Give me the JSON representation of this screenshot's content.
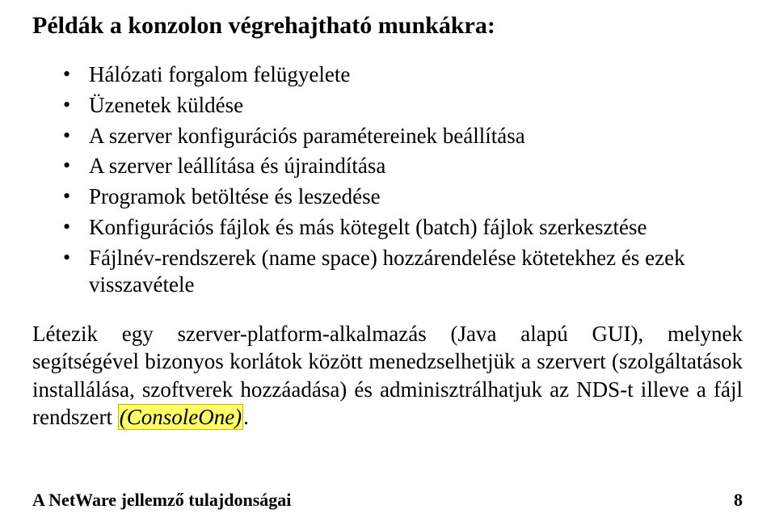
{
  "heading": "Példák a konzolon végrehajtható munkákra:",
  "bullets": [
    "Hálózati forgalom felügyelete",
    "Üzenetek küldése",
    "A szerver konfigurációs paramétereinek beállítása",
    "A szerver leállítása és újraindítása",
    "Programok betöltése és leszedése",
    "Konfigurációs fájlok és más kötegelt (batch) fájlok szerkesztése",
    "Fájlnév-rendszerek (name space) hozzárendelése kötetekhez és ezek visszavétele"
  ],
  "paragraph": {
    "pre": "Létezik egy szerver-platform-alkalmazás (Java alapú GUI), melynek segítségével bizonyos korlátok között menedzselhetjük a szervert (szolgáltatások installálása, szoftverek hozzáadása) és adminisztrálhatjuk az NDS-t illeve a fájl rendszert ",
    "highlight": "(ConsoleOne)",
    "post": "."
  },
  "footer": {
    "title": "A NetWare jellemző tulajdonságai",
    "page": "8"
  }
}
